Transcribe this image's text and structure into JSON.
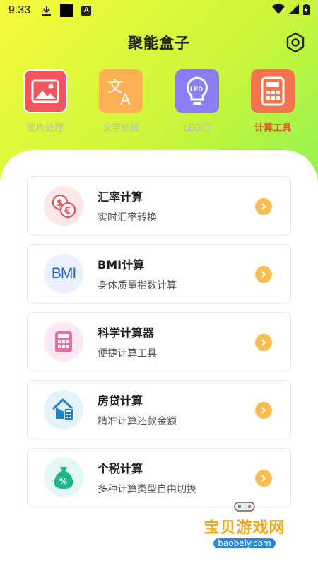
{
  "status": {
    "time": "9:33"
  },
  "header": {
    "title": "聚能盒子"
  },
  "tools": [
    {
      "label": "图片处理",
      "icon": "image-icon",
      "color": "#f2555e",
      "active": false
    },
    {
      "label": "文字处理",
      "icon": "translate-icon",
      "color": "#fdb152",
      "active": false
    },
    {
      "label": "LED灯",
      "icon": "led-bulb-icon",
      "color": "#8c7cf5",
      "active": false
    },
    {
      "label": "计算工具",
      "icon": "calculator-icon",
      "color": "#f5744f",
      "active": true
    }
  ],
  "cards": [
    {
      "title": "汇率计算",
      "subtitle": "实时汇率转换",
      "icon": "currency-exchange-icon",
      "bg": "#fde7e7"
    },
    {
      "title": "BMI计算",
      "subtitle": "身体质量指数计算",
      "icon": "bmi-icon",
      "icon_text": "BMI",
      "bg": "#eaf0fd"
    },
    {
      "title": "科学计算器",
      "subtitle": "便捷计算工具",
      "icon": "calculator-icon",
      "bg": "#fde9f3"
    },
    {
      "title": "房贷计算",
      "subtitle": "精准计算还款金额",
      "icon": "house-loan-icon",
      "bg": "#e3f3fc"
    },
    {
      "title": "个税计算",
      "subtitle": "多种计算类型自由切换",
      "icon": "money-bag-icon",
      "bg": "#e3f8f2"
    }
  ],
  "watermark": {
    "text": "宝贝游戏网",
    "url": "baobeiy.com"
  },
  "colors": {
    "accent": "#fbbe52",
    "active_tab": "#e2502d"
  }
}
